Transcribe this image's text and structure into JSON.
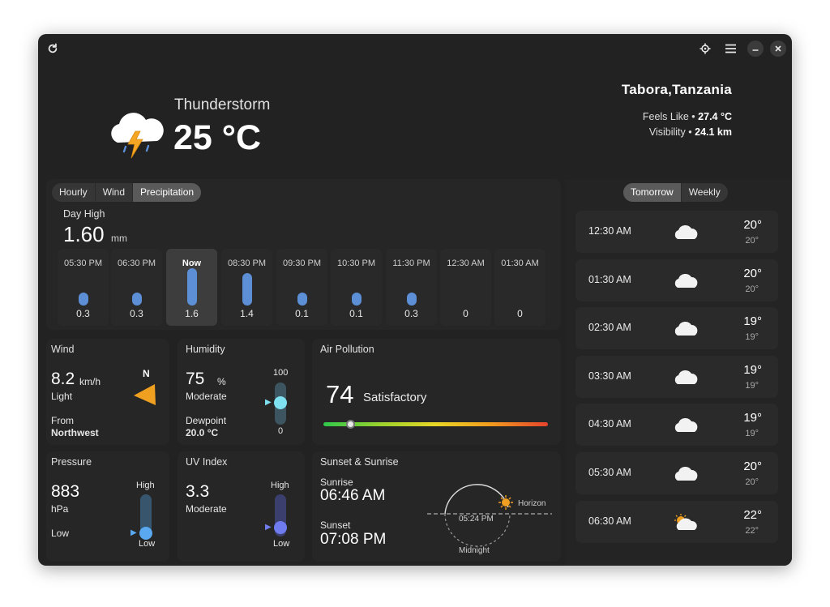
{
  "header": {
    "refresh_icon": "refresh-icon",
    "location_icon": "crosshair-icon",
    "menu_icon": "hamburger-menu-icon",
    "minimize_icon": "minimize-icon",
    "close_icon": "close-icon"
  },
  "current": {
    "condition": "Thunderstorm",
    "temperature": "25 °C",
    "location": "Tabora,Tanzania",
    "feels_like_label": "Feels Like •",
    "feels_like_value": "27.4 °C",
    "visibility_label": "Visibility •",
    "visibility_value": "24.1 km"
  },
  "tabs": {
    "hourly": "Hourly",
    "wind": "Wind",
    "precipitation": "Precipitation",
    "active": "Precipitation"
  },
  "precip": {
    "label": "Day High",
    "value": "1.60",
    "unit": "mm",
    "hours": [
      {
        "time": "05:30 PM",
        "value": "0.3",
        "amount": 0.3
      },
      {
        "time": "06:30 PM",
        "value": "0.3",
        "amount": 0.3
      },
      {
        "time": "Now",
        "value": "1.6",
        "amount": 1.6
      },
      {
        "time": "08:30 PM",
        "value": "1.4",
        "amount": 1.4
      },
      {
        "time": "09:30 PM",
        "value": "0.1",
        "amount": 0.1
      },
      {
        "time": "10:30 PM",
        "value": "0.1",
        "amount": 0.1
      },
      {
        "time": "11:30 PM",
        "value": "0.3",
        "amount": 0.3
      },
      {
        "time": "12:30 AM",
        "value": "0",
        "amount": 0
      },
      {
        "time": "01:30 AM",
        "value": "0",
        "amount": 0
      }
    ]
  },
  "wind": {
    "title": "Wind",
    "speed": "8.2",
    "unit": "km/h",
    "desc": "Light",
    "from_label": "From",
    "from_value": "Northwest",
    "compass_n": "N"
  },
  "humidity": {
    "title": "Humidity",
    "value": "75",
    "unit": "%",
    "desc": "Moderate",
    "dewpoint_label": "Dewpoint",
    "dewpoint_value": "20.0 °C",
    "max": "100",
    "min": "0",
    "level": 0.75
  },
  "pollution": {
    "title": "Air Pollution",
    "value": "74",
    "desc": "Satisfactory",
    "level": 0.12
  },
  "pressure": {
    "title": "Pressure",
    "value": "883",
    "unit": "hPa",
    "desc": "Low",
    "high": "High",
    "low": "Low",
    "level": 0.1
  },
  "uv": {
    "title": "UV Index",
    "value": "3.3",
    "desc": "Moderate",
    "high": "High",
    "low": "Low",
    "level": 0.3
  },
  "sun": {
    "title": "Sunset & Sunrise",
    "sunrise_label": "Sunrise",
    "sunrise": "06:46 AM",
    "sunset_label": "Sunset",
    "sunset": "07:08 PM",
    "current_time": "05:24 PM",
    "horizon": "Horizon",
    "midnight": "Midnight"
  },
  "forecast": {
    "tabs": [
      "Tomorrow",
      "Weekly"
    ],
    "active": "Tomorrow",
    "rows": [
      {
        "time": "12:30 AM",
        "high": "20°",
        "low": "20°",
        "icon": "cloud-icon"
      },
      {
        "time": "01:30 AM",
        "high": "20°",
        "low": "20°",
        "icon": "cloud-icon"
      },
      {
        "time": "02:30 AM",
        "high": "19°",
        "low": "19°",
        "icon": "cloud-icon"
      },
      {
        "time": "03:30 AM",
        "high": "19°",
        "low": "19°",
        "icon": "cloud-icon"
      },
      {
        "time": "04:30 AM",
        "high": "19°",
        "low": "19°",
        "icon": "cloud-icon"
      },
      {
        "time": "05:30 AM",
        "high": "20°",
        "low": "20°",
        "icon": "cloud-icon"
      },
      {
        "time": "06:30 AM",
        "high": "22°",
        "low": "22°",
        "icon": "partly-sunny-icon"
      }
    ]
  },
  "colors": {
    "background": "#222222",
    "card": "#262626",
    "accent_blue": "#5c8fd6",
    "humidity_accent": "#7fe0f0",
    "pressure_accent": "#5aa8f0",
    "uv_accent": "#6f7cf0",
    "wind_arrow": "#f0a020",
    "sun": "#f0a020"
  }
}
